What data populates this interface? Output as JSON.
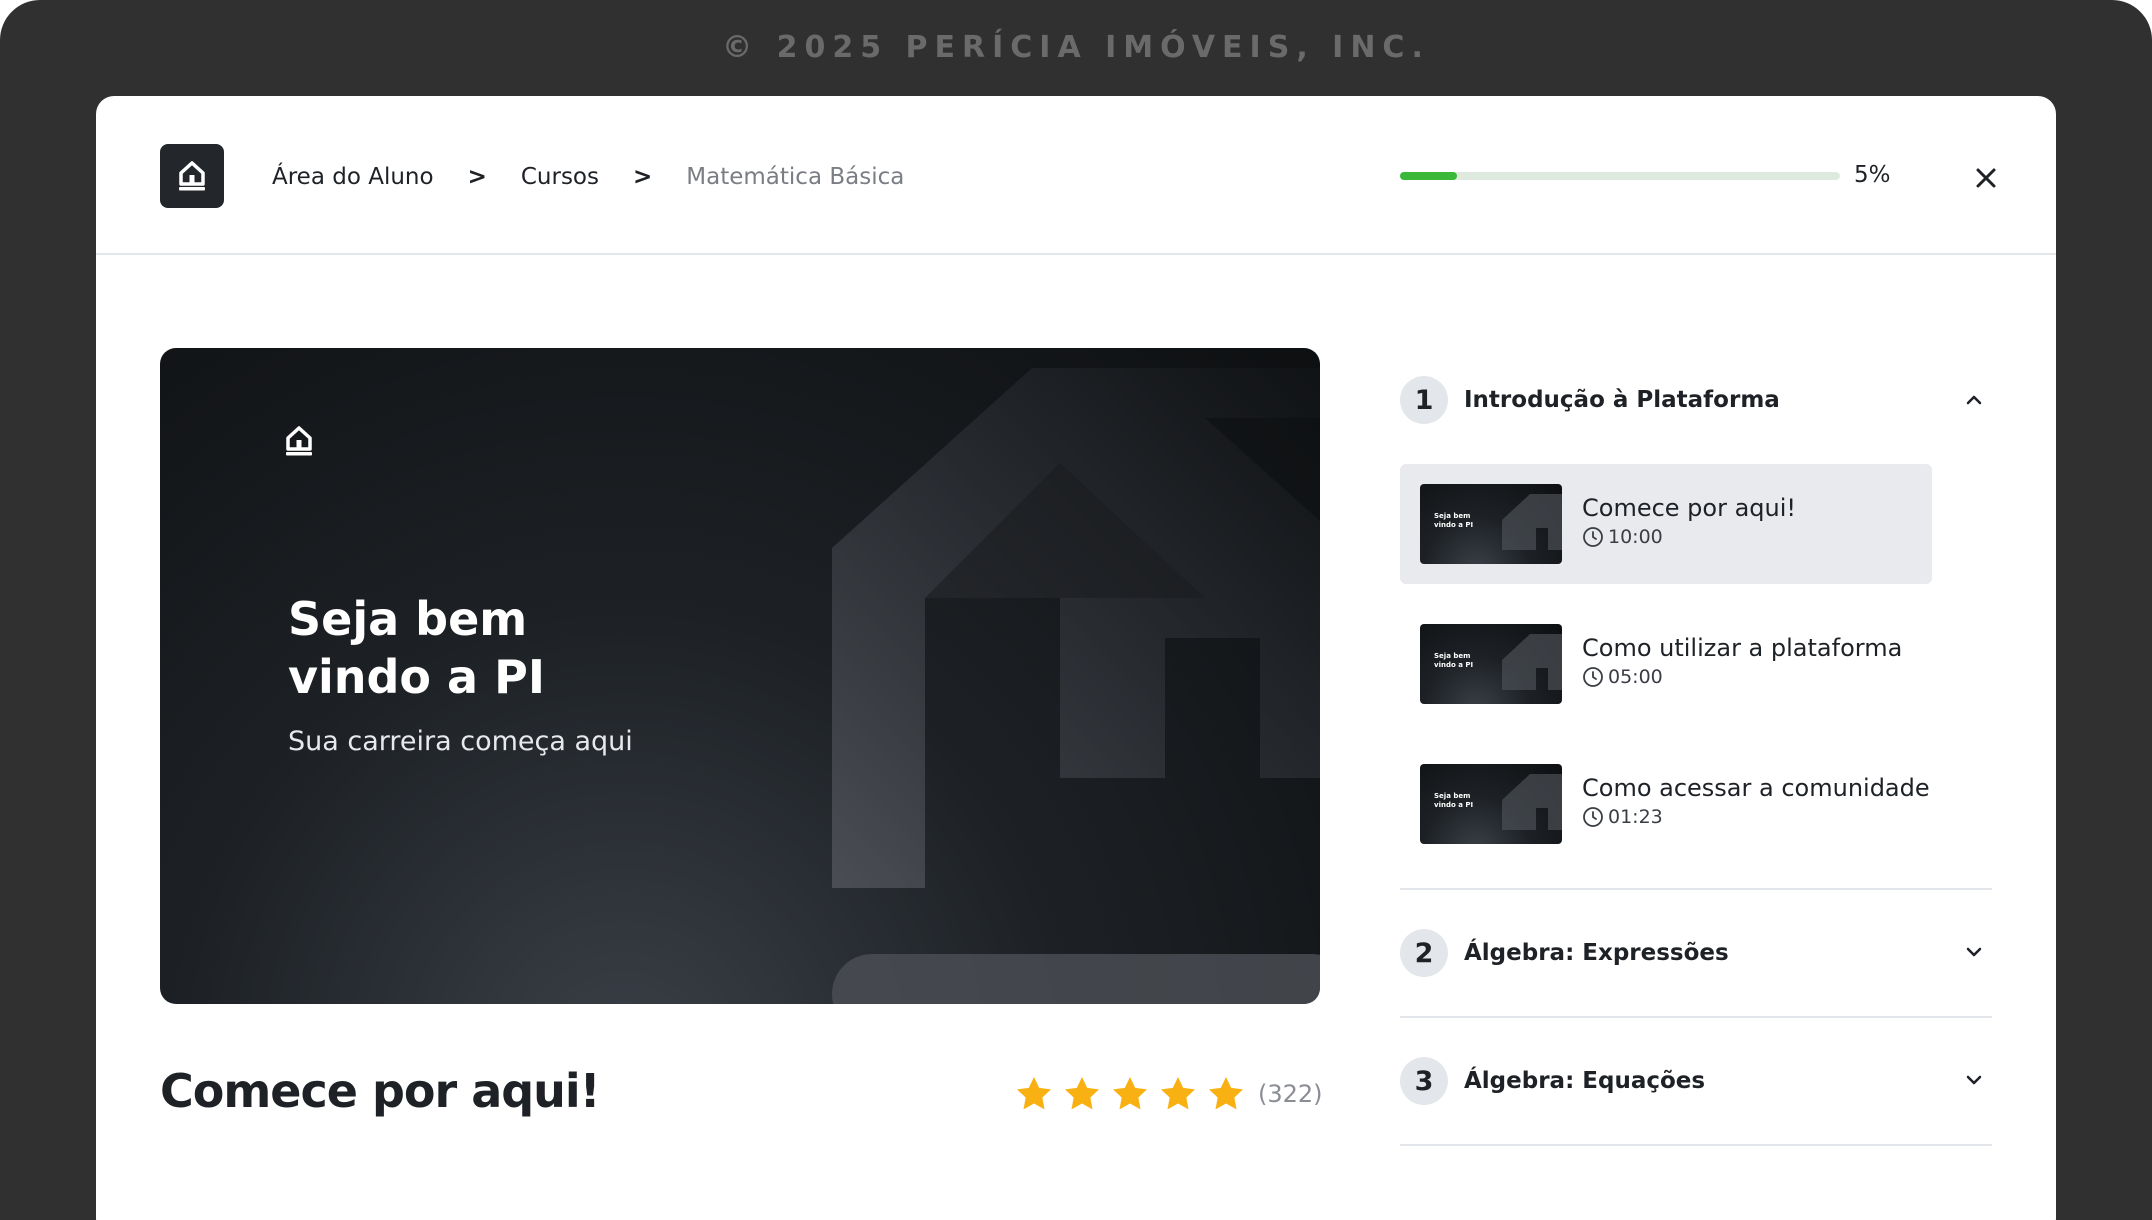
{
  "footer": {
    "copyright": "© 2025 PERÍCIA IMÓVEIS, INC."
  },
  "header": {
    "breadcrumb": [
      "Área do Aluno",
      ">",
      "Cursos",
      ">",
      "Matemática Básica"
    ],
    "progress": {
      "value": 0.05,
      "label": "5%"
    }
  },
  "video": {
    "title_line1": "Seja bem",
    "title_line2": "vindo a PI",
    "subtitle": "Sua carreira começa aqui"
  },
  "lesson": {
    "title": "Comece por aqui!",
    "rating": {
      "stars": 5,
      "count": "(322)"
    }
  },
  "modules": [
    {
      "number": "1",
      "title": "Introdução à Plataforma",
      "expanded": true,
      "lessons": [
        {
          "title": "Comece por aqui!",
          "duration": "10:00",
          "active": true
        },
        {
          "title": "Como utilizar a plataforma",
          "duration": "05:00",
          "active": false
        },
        {
          "title": "Como acessar a comunidade",
          "duration": "01:23",
          "active": false
        }
      ]
    },
    {
      "number": "2",
      "title": "Álgebra: Expressões",
      "expanded": false
    },
    {
      "number": "3",
      "title": "Álgebra: Equações",
      "expanded": false
    }
  ],
  "thumbnail": {
    "text_line1": "Seja bem",
    "text_line2": "vindo a PI"
  },
  "colors": {
    "accent": "#3ab83a",
    "star": "#f8b012",
    "dark": "#23272b"
  },
  "icons": {
    "logo": "house-logo-icon",
    "close": "close-icon",
    "chevron_up": "chevron-up-icon",
    "chevron_down": "chevron-down-icon",
    "clock": "clock-icon",
    "star": "star-icon"
  }
}
